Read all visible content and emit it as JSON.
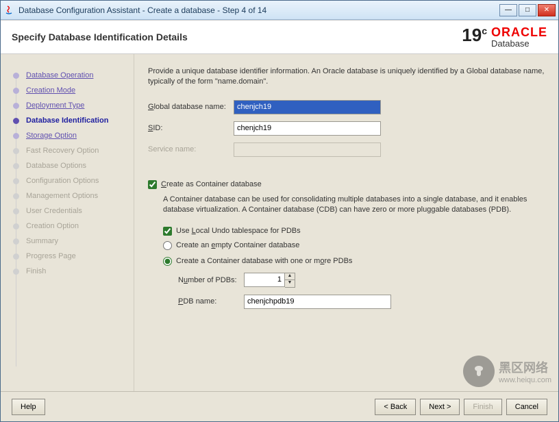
{
  "window": {
    "title": "Database Configuration Assistant - Create a database - Step 4 of 14"
  },
  "header": {
    "title": "Specify Database Identification Details",
    "brand_version": "19",
    "brand_sup": "c",
    "brand_oracle": "ORACLE",
    "brand_db": "Database"
  },
  "sidebar": {
    "steps": [
      {
        "label": "Database Operation",
        "state": "done"
      },
      {
        "label": "Creation Mode",
        "state": "done"
      },
      {
        "label": "Deployment Type",
        "state": "done"
      },
      {
        "label": "Database Identification",
        "state": "current"
      },
      {
        "label": "Storage Option",
        "state": "next"
      },
      {
        "label": "Fast Recovery Option",
        "state": "future"
      },
      {
        "label": "Database Options",
        "state": "future"
      },
      {
        "label": "Configuration Options",
        "state": "future"
      },
      {
        "label": "Management Options",
        "state": "future"
      },
      {
        "label": "User Credentials",
        "state": "future"
      },
      {
        "label": "Creation Option",
        "state": "future"
      },
      {
        "label": "Summary",
        "state": "future"
      },
      {
        "label": "Progress Page",
        "state": "future"
      },
      {
        "label": "Finish",
        "state": "future"
      }
    ]
  },
  "intro": "Provide a unique database identifier information. An Oracle database is uniquely identified by a Global database name, typically of the form \"name.domain\".",
  "fields": {
    "global_db_label_pre": "G",
    "global_db_label": "lobal database name:",
    "global_db_value": "chenjch19",
    "sid_label_pre": "S",
    "sid_label": "ID:",
    "sid_value": "chenjch19",
    "service_label": "Service name:",
    "service_value": ""
  },
  "cdb": {
    "create_label_pre": "C",
    "create_label": "reate as Container database",
    "create_checked": true,
    "desc": "A Container database can be used for consolidating multiple databases into a single database, and it enables database virtualization. A Container database (CDB) can have zero or more pluggable databases (PDB).",
    "undo_label_pre": "Use ",
    "undo_label_u": "L",
    "undo_label_post": "ocal Undo tablespace for PDBs",
    "undo_checked": true,
    "radio_empty_pre": "Create an ",
    "radio_empty_u": "e",
    "radio_empty_post": "mpty Container database",
    "radio_pdbs_pre": "Create a Container database with one or m",
    "radio_pdbs_u": "o",
    "radio_pdbs_post": "re PDBs",
    "radio_selected": "pdbs",
    "num_pdbs_label_pre": "N",
    "num_pdbs_label_u": "u",
    "num_pdbs_label_post": "mber of PDBs:",
    "num_pdbs_value": "1",
    "pdb_name_label_pre": "P",
    "pdb_name_label_u": "D",
    "pdb_name_label_post": "B name:",
    "pdb_name_value": "chenjchpdb19"
  },
  "buttons": {
    "help": "Help",
    "back": "< Back",
    "next": "Next >",
    "finish": "Finish",
    "cancel": "Cancel"
  },
  "watermark": {
    "cn": "黑区网络",
    "url": "www.heiqu.com"
  }
}
